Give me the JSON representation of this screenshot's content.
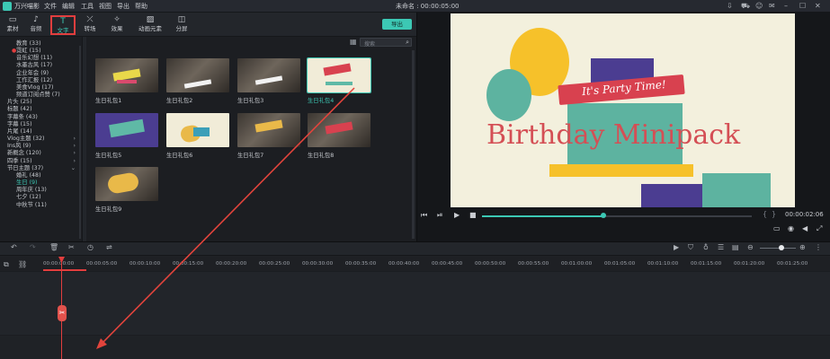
{
  "menubar": {
    "app_name": "万兴喵影",
    "items": [
      "文件",
      "编辑",
      "工具",
      "视图",
      "导出",
      "帮助"
    ],
    "doc_title": "未命名 : 00:00:05:00"
  },
  "toolbar": {
    "items": [
      {
        "label": "素材",
        "icon": "folder-icon"
      },
      {
        "label": "音频",
        "icon": "music-icon"
      },
      {
        "label": "文字",
        "icon": "text-icon"
      },
      {
        "label": "转场",
        "icon": "transition-icon"
      },
      {
        "label": "效果",
        "icon": "effects-icon"
      },
      {
        "label": "动画元素",
        "icon": "image-icon"
      },
      {
        "label": "分屏",
        "icon": "split-screen-icon"
      }
    ],
    "export_label": "导出"
  },
  "sidebar": {
    "categories": [
      "教育 (33)",
      "霓虹 (15)",
      "音乐幻想 (11)",
      "水墨古风 (17)",
      "企业年会 (9)",
      "工作汇报 (12)",
      "美食Vlog (17)",
      "频道订阅点赞 (7)",
      "片头 (25)",
      "标题 (42)",
      "字幕条 (43)",
      "字幕 (15)",
      "片尾 (14)",
      "Vlog主题 (32)",
      "Ins风 (9)",
      "新概念 (120)",
      "四季 (15)",
      "节日主题 (37)",
      "婚礼 (48)",
      "生日 (9)",
      "周年庆 (13)",
      "七夕 (12)",
      "中秋节 (11)"
    ]
  },
  "gallery": {
    "search_placeholder": "搜索",
    "items": [
      "生日礼包1",
      "生日礼包2",
      "生日礼包3",
      "生日礼包4",
      "生日礼包5",
      "生日礼包6",
      "生日礼包7",
      "生日礼包8",
      "生日礼包9"
    ]
  },
  "preview": {
    "title": "Birthday Minipack",
    "banner": "It's Party Time!",
    "timecode": "00:00:02:06",
    "bracket_left": "{",
    "bracket_right": "}"
  },
  "timeline": {
    "ruler": [
      "00:00:00:00",
      "00:00:05:00",
      "00:00:10:00",
      "00:00:15:00",
      "00:00:20:00",
      "00:00:25:00",
      "00:00:30:00",
      "00:00:35:00",
      "00:00:40:00",
      "00:00:45:00",
      "00:00:50:00",
      "00:00:55:00",
      "00:01:00:00",
      "00:01:05:00",
      "00:01:10:00",
      "00:01:15:00",
      "00:01:20:00",
      "00:01:25:00"
    ]
  }
}
